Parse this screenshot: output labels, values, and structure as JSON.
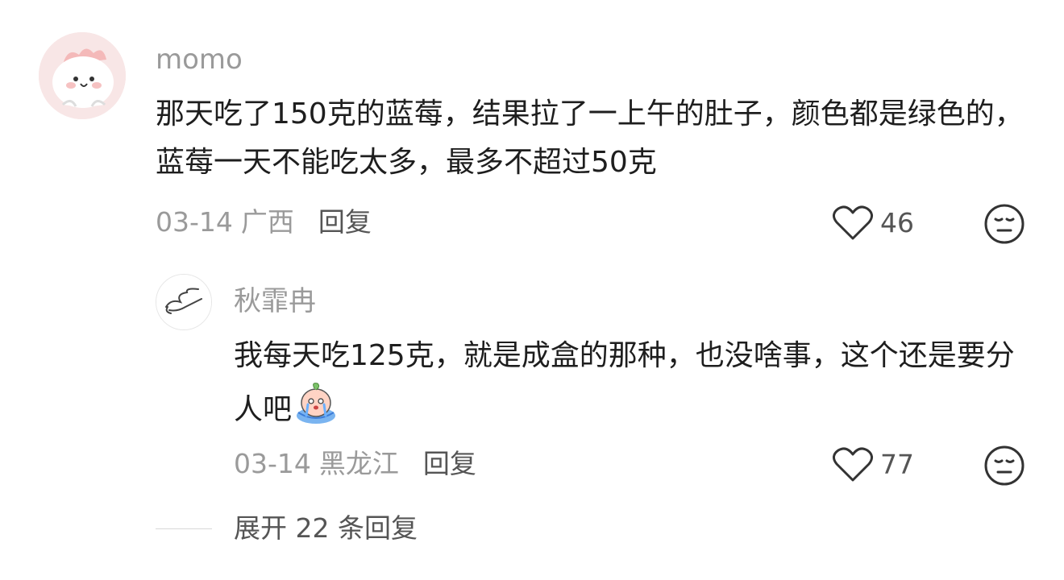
{
  "comment": {
    "username": "momo",
    "text": "那天吃了150克的蓝莓，结果拉了一上午的肚子，颜色都是绿色的，蓝莓一天不能吃太多，最多不超过50克",
    "date": "03-14",
    "location": "广西",
    "reply_label": "回复",
    "like_count": "46",
    "avatar_icon": "cartoon-bunny-avatar"
  },
  "reply": {
    "username": "秋霏冉",
    "text": "我每天吃125克，就是成盒的那种，也没啥事，这个还是要分人吧",
    "emoji": "crying-peach-emoji",
    "date": "03-14",
    "location": "黑龙江",
    "reply_label": "回复",
    "like_count": "77",
    "avatar_icon": "wing-sketch-avatar"
  },
  "expand_label": "展开 22 条回复",
  "colors": {
    "meta_gray": "#9a9a9a",
    "text_dark": "#1e1e1e",
    "action_gray": "#555555"
  }
}
